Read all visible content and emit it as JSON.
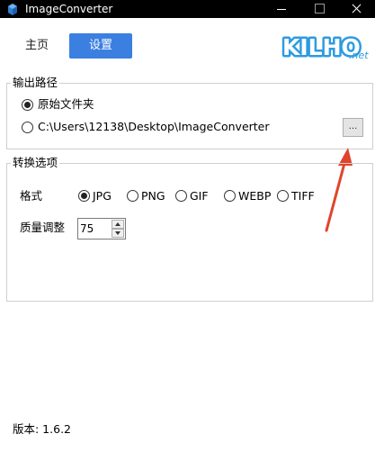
{
  "window": {
    "title": "ImageConverter"
  },
  "nav": {
    "home": "主页",
    "settings": "设置"
  },
  "logo": {
    "main": "KILHO",
    "suffix": ".net"
  },
  "output_path": {
    "legend": "输出路径",
    "option_original": "原始文件夹",
    "option_custom": "C:\\Users\\12138\\Desktop\\ImageConverter",
    "browse_label": "...",
    "selected": "原始文件夹"
  },
  "convert_options": {
    "legend": "转换选项",
    "format_label": "格式",
    "formats": [
      "JPG",
      "PNG",
      "GIF",
      "WEBP",
      "TIFF"
    ],
    "selected_format": "JPG",
    "quality_label": "质量调整",
    "quality_value": "75"
  },
  "footer": {
    "version": "版本: 1.6.2"
  },
  "colors": {
    "accent": "#3b7fe0",
    "arrow": "#e0452b",
    "logo": "#2e9be0"
  }
}
